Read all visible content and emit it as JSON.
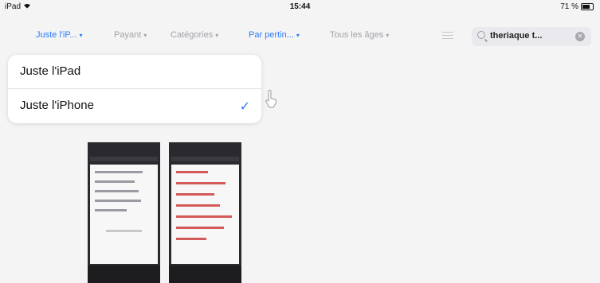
{
  "status": {
    "device": "iPad",
    "time": "15:44",
    "battery": "71 %",
    "battery_level": 0.71
  },
  "filters": [
    {
      "label": "Juste l'iP...",
      "active": true
    },
    {
      "label": "Payant",
      "active": false
    },
    {
      "label": "Catégories",
      "active": false
    },
    {
      "label": "Par pertin...",
      "active": true
    },
    {
      "label": "Tous les âges",
      "active": false
    }
  ],
  "search": {
    "value": "theriaque t..."
  },
  "dropdown": {
    "items": [
      {
        "label": "Juste l'iPad",
        "selected": false
      },
      {
        "label": "Juste l'iPhone",
        "selected": true
      }
    ]
  },
  "colors": {
    "accent": "#2f7cf6",
    "inactive": "#a3a3a8"
  },
  "icons": [
    "wifi-icon",
    "battery-icon",
    "list-icon",
    "search-icon",
    "clear-icon",
    "checkmark-icon",
    "cursor-icon"
  ]
}
